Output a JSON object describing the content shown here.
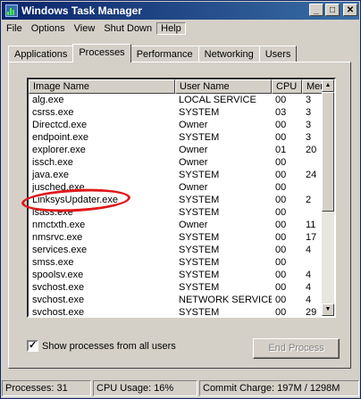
{
  "window": {
    "title": "Windows Task Manager"
  },
  "title_buttons": {
    "minimize": "_",
    "maximize": "□",
    "close": "✕"
  },
  "menu": [
    "File",
    "Options",
    "View",
    "Shut Down",
    "Help"
  ],
  "tabs": [
    "Applications",
    "Processes",
    "Performance",
    "Networking",
    "Users"
  ],
  "columns": [
    "Image Name",
    "User Name",
    "CPU",
    "Mem"
  ],
  "processes": [
    {
      "name": "alg.exe",
      "user": "LOCAL SERVICE",
      "cpu": "00",
      "mem": "3"
    },
    {
      "name": "csrss.exe",
      "user": "SYSTEM",
      "cpu": "03",
      "mem": "3"
    },
    {
      "name": "Directcd.exe",
      "user": "Owner",
      "cpu": "00",
      "mem": "3"
    },
    {
      "name": "endpoint.exe",
      "user": "SYSTEM",
      "cpu": "00",
      "mem": "3"
    },
    {
      "name": "explorer.exe",
      "user": "Owner",
      "cpu": "01",
      "mem": "20"
    },
    {
      "name": "issch.exe",
      "user": "Owner",
      "cpu": "00",
      "mem": ""
    },
    {
      "name": "java.exe",
      "user": "SYSTEM",
      "cpu": "00",
      "mem": "24"
    },
    {
      "name": "jusched.exe",
      "user": "Owner",
      "cpu": "00",
      "mem": ""
    },
    {
      "name": "LinksysUpdater.exe",
      "user": "SYSTEM",
      "cpu": "00",
      "mem": "2"
    },
    {
      "name": "lsass.exe",
      "user": "SYSTEM",
      "cpu": "00",
      "mem": ""
    },
    {
      "name": "nmctxth.exe",
      "user": "Owner",
      "cpu": "00",
      "mem": "11"
    },
    {
      "name": "nmsrvc.exe",
      "user": "SYSTEM",
      "cpu": "00",
      "mem": "17"
    },
    {
      "name": "services.exe",
      "user": "SYSTEM",
      "cpu": "00",
      "mem": "4"
    },
    {
      "name": "smss.exe",
      "user": "SYSTEM",
      "cpu": "00",
      "mem": ""
    },
    {
      "name": "spoolsv.exe",
      "user": "SYSTEM",
      "cpu": "00",
      "mem": "4"
    },
    {
      "name": "svchost.exe",
      "user": "SYSTEM",
      "cpu": "00",
      "mem": "4"
    },
    {
      "name": "svchost.exe",
      "user": "NETWORK SERVICE",
      "cpu": "00",
      "mem": "4"
    },
    {
      "name": "svchost.exe",
      "user": "SYSTEM",
      "cpu": "00",
      "mem": "29"
    }
  ],
  "show_all": {
    "label": "Show processes from all users",
    "checked": true,
    "check_glyph": "✓"
  },
  "end_process_label": "End Process",
  "scroll_arrows": {
    "up": "▲",
    "down": "▼"
  },
  "status": {
    "processes": "Processes: 31",
    "cpu": "CPU Usage: 16%",
    "commit": "Commit Charge: 197M / 1298M"
  },
  "colors": {
    "titlebar": "#0a246a",
    "annotation": "#e0181a",
    "face": "#d4d0c8"
  }
}
